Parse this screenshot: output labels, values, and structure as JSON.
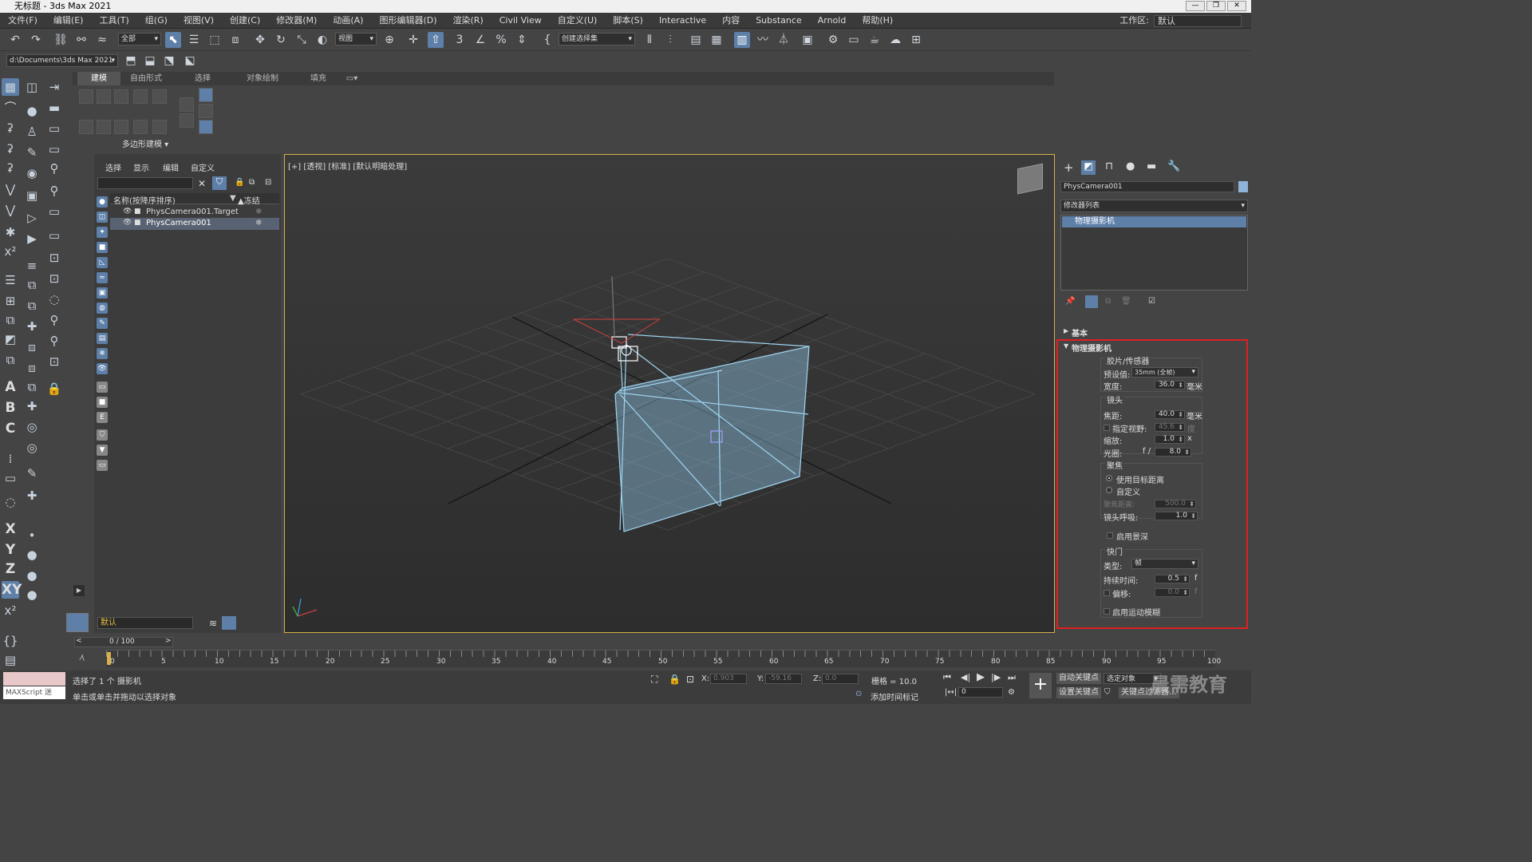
{
  "window": {
    "title": "无标题 - 3ds Max 2021",
    "buttons": [
      "—",
      "❐",
      "✕"
    ]
  },
  "menu": [
    "文件(F)",
    "编辑(E)",
    "工具(T)",
    "组(G)",
    "视图(V)",
    "创建(C)",
    "修改器(M)",
    "动画(A)",
    "图形编辑器(D)",
    "渲染(R)",
    "Civil View",
    "自定义(U)",
    "脚本(S)",
    "Interactive",
    "内容",
    "Substance",
    "Arnold",
    "帮助(H)"
  ],
  "workspace": {
    "label": "工作区:",
    "value": "默认"
  },
  "toolbar": {
    "selection_filter": "全部",
    "ref_coord": "视图",
    "named_selection": "创建选择集",
    "path": "d:\\Documents\\3ds Max 2021"
  },
  "ribbon": {
    "tabs": [
      "建模",
      "自由形式",
      "选择",
      "对象绘制",
      "填充"
    ],
    "group_label": "多边形建模 ▾"
  },
  "scene_explorer": {
    "tabs": [
      "选择",
      "显示",
      "编辑",
      "自定义"
    ],
    "col_name": "名称(按降序排序)",
    "col_freeze": "▲冻结",
    "rows": [
      {
        "name": "PhysCamera001.Target",
        "freeze": "❄"
      },
      {
        "name": "PhysCamera001",
        "freeze": "❄"
      }
    ],
    "layer": "默认"
  },
  "viewport": {
    "label": "[+] [透视] [标准] [默认明暗处理]"
  },
  "command_panel": {
    "object_name": "PhysCamera001",
    "modifier_list": "修改器列表",
    "stack_item": "物理摄影机",
    "rollout_basic": "基本",
    "rollout_main": "物理摄影机",
    "film_group": "胶片/传感器",
    "preset_label": "预设值:",
    "preset_value": "35mm (全帧)",
    "width_label": "宽度:",
    "width_value": "36.0",
    "mm": "毫米",
    "lens_group": "镜头",
    "focal_label": "焦距:",
    "focal_value": "40.0",
    "fov_label": "指定视野:",
    "fov_value": "45.6",
    "degree": "度",
    "zoom_label": "缩放:",
    "zoom_value": "1.0",
    "x_unit": "x",
    "aperture_label": "光圈:",
    "aperture_f": "f /",
    "aperture_value": "8.0",
    "focus_group": "聚焦",
    "use_target": "使用目标距离",
    "custom": "自定义",
    "focus_dist_label": "聚焦距离:",
    "focus_dist_value": "500.0",
    "breathing_label": "镜头呼吸:",
    "breathing_value": "1.0",
    "dof": "启用景深",
    "shutter_group": "快门",
    "type_label": "类型:",
    "type_value": "帧",
    "duration_label": "持续时间:",
    "duration_value": "0.5",
    "f_unit": "f",
    "offset_label": "偏移:",
    "offset_value": "0.0",
    "motion_blur": "启用运动模糊"
  },
  "timeline": {
    "frame": "0 / 100",
    "ticks": [
      "0",
      "5",
      "10",
      "15",
      "20",
      "25",
      "30",
      "35",
      "40",
      "45",
      "50",
      "55",
      "60",
      "65",
      "70",
      "75",
      "80",
      "85",
      "90",
      "95",
      "100"
    ]
  },
  "status": {
    "script_label": "MAXScript 迷",
    "selected": "选择了 1 个 摄影机",
    "hint": "单击或单击并拖动以选择对象",
    "x_label": "X:",
    "x_value": "0.903",
    "y_label": "Y:",
    "y_value": "-59.16",
    "z_label": "Z:",
    "z_value": "0.0",
    "grid": "栅格 = 10.0",
    "add_time_tag": "添加时间标记",
    "auto_key": "自动关键点",
    "set_key": "设置关键点",
    "selected_objects": "选定对象",
    "key_filters": "关键点过滤器...",
    "frame_field": "0"
  },
  "watermark": "晨需教育"
}
